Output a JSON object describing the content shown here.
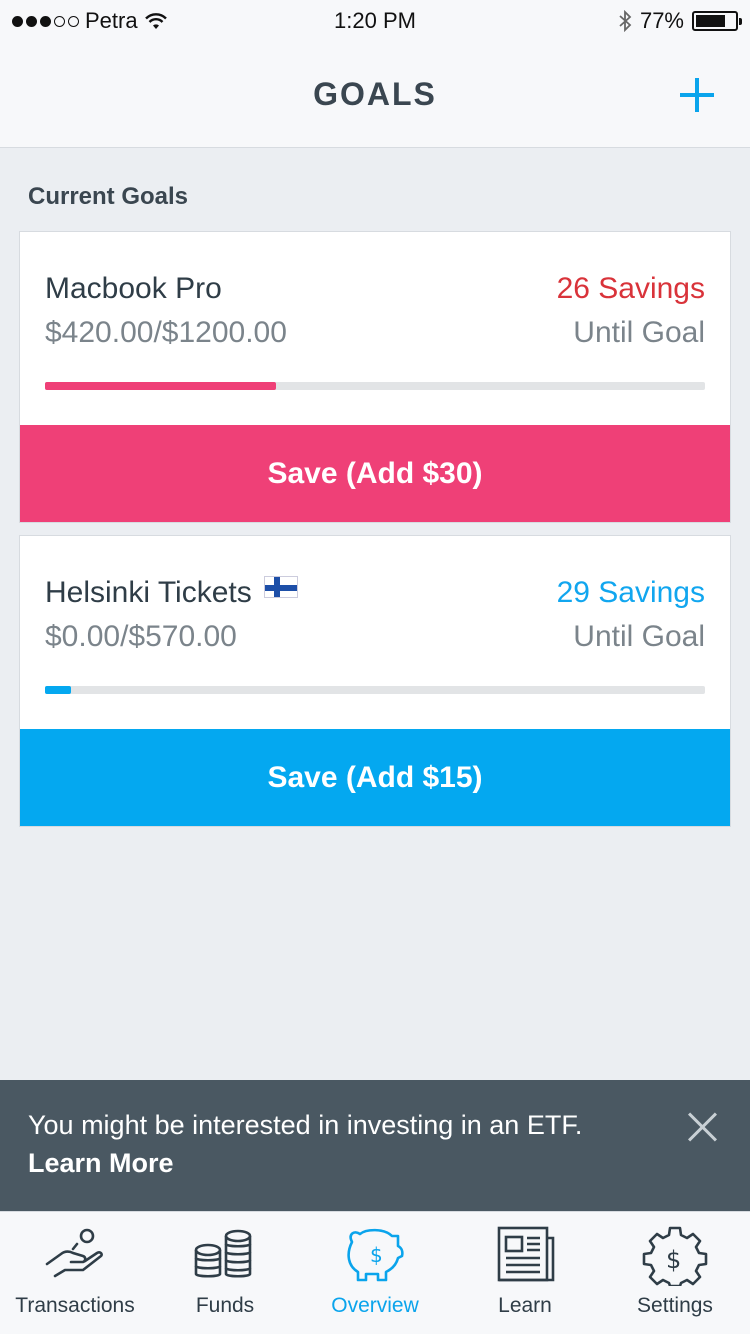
{
  "status_bar": {
    "carrier": "Petra",
    "time": "1:20 PM",
    "battery": "77%"
  },
  "header": {
    "title": "GOALS",
    "add_icon": "plus-icon"
  },
  "section": {
    "label": "Current Goals"
  },
  "goals": [
    {
      "name": "Macbook Pro",
      "amount": "$420.00/$1200.00",
      "savings": "26 Savings",
      "until": "Until Goal",
      "progress": 0.35,
      "color": "#ef4077",
      "savings_color": "#d9333a",
      "button_label": "Save (Add $30)"
    },
    {
      "name": "Helsinki Tickets",
      "flag": "finland-flag-icon",
      "amount": "$0.00/$570.00",
      "savings": "29 Savings",
      "until": "Until Goal",
      "progress": 0.04,
      "color": "#04a8f0",
      "savings_color": "#11a6ef",
      "button_label": "Save (Add $15)"
    }
  ],
  "banner": {
    "text": "You might be interested in investing in an ETF.",
    "link": "Learn More",
    "close_icon": "close-icon"
  },
  "tabs": [
    {
      "label": "Transactions",
      "icon": "hand-coin-icon"
    },
    {
      "label": "Funds",
      "icon": "coin-stack-icon"
    },
    {
      "label": "Overview",
      "icon": "piggy-bank-icon",
      "active": true
    },
    {
      "label": "Learn",
      "icon": "newspaper-icon"
    },
    {
      "label": "Settings",
      "icon": "gear-dollar-icon"
    }
  ],
  "colors": {
    "accent": "#0aa4ec",
    "banner": "#4a5862"
  }
}
